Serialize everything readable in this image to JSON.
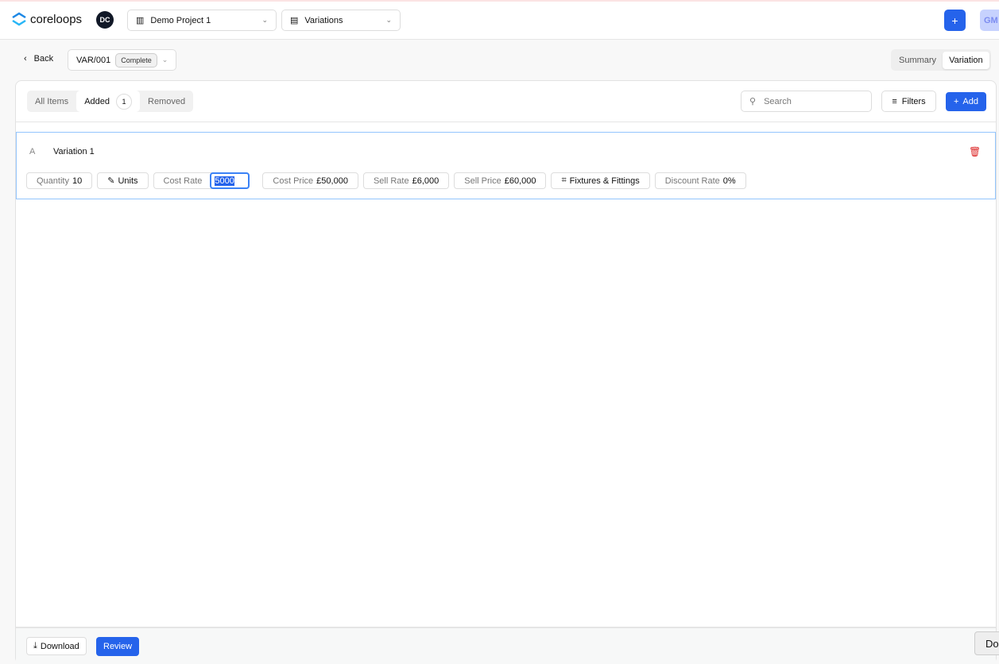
{
  "header": {
    "brand": "coreloops",
    "workspace_initials": "DC",
    "project": "Demo Project 1",
    "module": "Variations",
    "user_initials": "GM"
  },
  "subheader": {
    "back": "Back",
    "variation_code": "VAR/001",
    "status": "Complete",
    "views": [
      "Summary",
      "Variation"
    ],
    "active_view": "Variation"
  },
  "toolbar": {
    "tabs": [
      {
        "label": "All Items"
      },
      {
        "label": "Added",
        "count": "1"
      },
      {
        "label": "Removed"
      }
    ],
    "active_tab": "Added",
    "search_placeholder": "Search",
    "filters": "Filters",
    "add": "Add"
  },
  "item": {
    "letter": "A",
    "name": "Variation 1",
    "quantity_label": "Quantity",
    "quantity": "10",
    "unit": "Units",
    "cost_rate_label": "Cost Rate",
    "cost_rate_input": "5000",
    "cost_price_label": "Cost Price",
    "cost_price": "£50,000",
    "sell_rate_label": "Sell Rate",
    "sell_rate": "£6,000",
    "sell_price_label": "Sell Price",
    "sell_price": "£60,000",
    "category": "Fixtures & Fittings",
    "discount_label": "Discount Rate",
    "discount": "0%"
  },
  "footer": {
    "download": "Download",
    "review": "Review",
    "overlay": "Do"
  },
  "colors": {
    "accent": "#2563eb",
    "danger": "#dc2626"
  }
}
